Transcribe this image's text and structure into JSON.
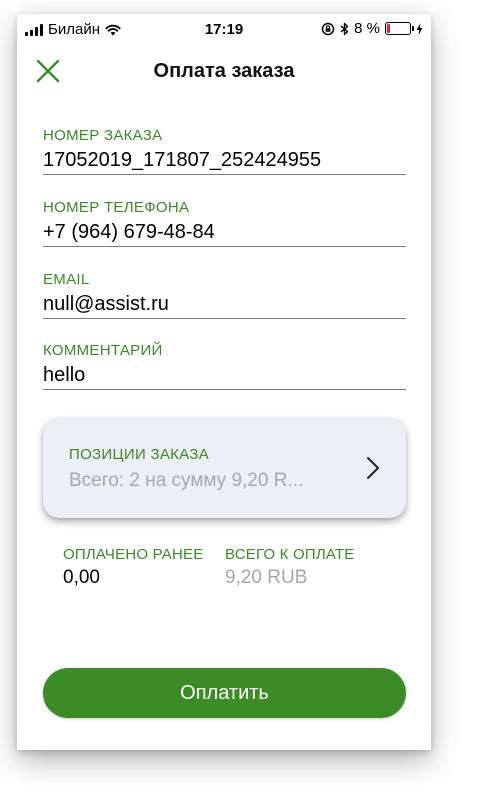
{
  "status_bar": {
    "carrier": "Билайн",
    "time": "17:19",
    "battery_percent": "8 %",
    "battery_level": 0.08,
    "icons": [
      "signal-icon",
      "wifi-icon",
      "orientation-lock-icon",
      "bluetooth-icon",
      "battery-icon",
      "charging-icon"
    ]
  },
  "header": {
    "title": "Оплата заказа",
    "close_icon": "close-icon"
  },
  "fields": {
    "order_number": {
      "label": "НОМЕР ЗАКАЗА",
      "value": "17052019_171807_252424955"
    },
    "phone": {
      "label": "НОМЕР ТЕЛЕФОНА",
      "value": "+7 (964) 679-48-84"
    },
    "email": {
      "label": "EMAIL",
      "value": "null@assist.ru"
    },
    "comment": {
      "label": "КОММЕНТАРИЙ",
      "value": "hello"
    }
  },
  "order_items": {
    "label": "ПОЗИЦИИ ЗАКАЗА",
    "summary": "Всего: 2 на сумму 9,20 R..."
  },
  "totals": {
    "paid_label": "ОПЛАЧЕНО РАНЕЕ",
    "paid_value": "0,00",
    "due_label": "ВСЕГО К ОПЛАТЕ",
    "due_value": "9,20 RUB"
  },
  "pay_button": {
    "label": "Оплатить"
  },
  "colors": {
    "accent_green": "#3d8b27",
    "label_green": "#3a8a2a",
    "muted_gray": "#a6a6ac",
    "card_bg": "#eeeef5",
    "battery_red": "#e0262b"
  }
}
